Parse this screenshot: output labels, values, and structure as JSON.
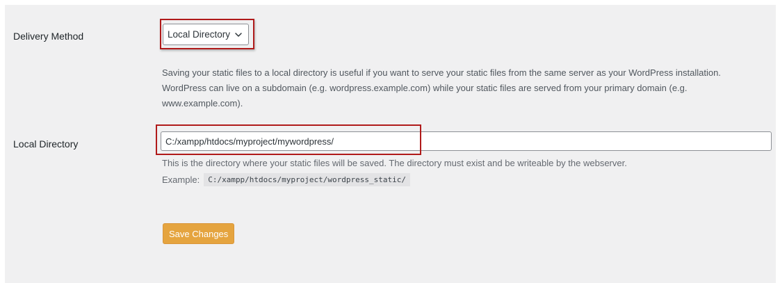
{
  "settings": {
    "delivery_method": {
      "label": "Delivery Method",
      "selected": "Local Directory",
      "description": "Saving your static files to a local directory is useful if you want to serve your static files from the same server as your WordPress installation. WordPress can live on a subdomain (e.g. wordpress.example.com) while your static files are served from your primary domain (e.g. www.example.com)."
    },
    "local_directory": {
      "label": "Local Directory",
      "value": "C:/xampp/htdocs/myproject/mywordpress/",
      "help": "This is the directory where your static files will be saved. The directory must exist and be writeable by the webserver.",
      "example_label": "Example:",
      "example_value": "C:/xampp/htdocs/myproject/wordpress_static/"
    }
  },
  "actions": {
    "save_label": "Save Changes"
  },
  "colors": {
    "panel_bg": "#f0f0f1",
    "highlight": "#b01a1a",
    "save_button": "#e5a43f"
  },
  "icons": {
    "select_caret": "chevron-down-icon"
  }
}
